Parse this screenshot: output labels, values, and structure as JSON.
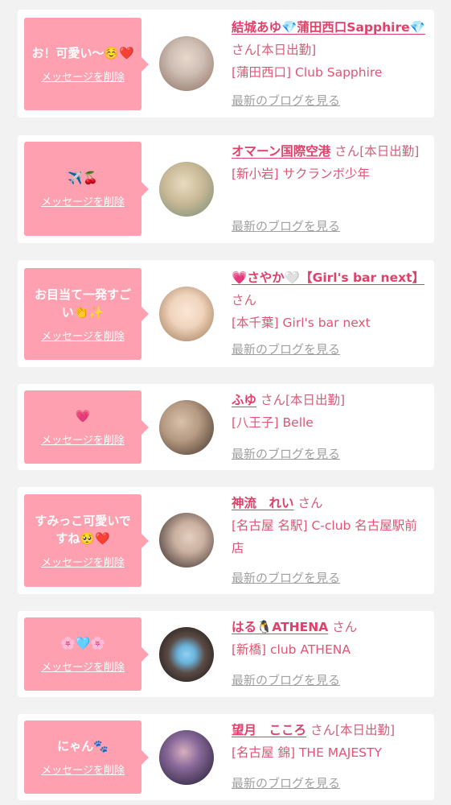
{
  "delete_label": "メッセージを削除",
  "blog_label": "最新のブログを見る",
  "san_label": "さん",
  "cards": [
    {
      "message": "お！可愛い〜☺️❤️",
      "name": "結城あゆ💎蒲田西口Sapphire💎",
      "status": "[本日出勤]",
      "shop": "[蒲田西口] Club Sapphire",
      "avatar_colors": [
        "#cdbdb3",
        "#8e6e60"
      ]
    },
    {
      "message": "✈️🍒",
      "name": "オマーン国際空港",
      "status": "[本日出勤]",
      "shop": "[新小岩] サクランボ少年",
      "avatar_colors": [
        "#c8b896",
        "#6f8a76"
      ]
    },
    {
      "message": "お目当て一発すごい👏✨",
      "name": "💗さやか🤍【Girl's bar next】",
      "status": "",
      "shop": "[本千葉] Girl's bar next",
      "avatar_colors": [
        "#f0d4bd",
        "#9a7450"
      ]
    },
    {
      "message": "💗",
      "name": "ふゆ",
      "status": "[本日出勤]",
      "shop": "[八王子] Belle",
      "avatar_colors": [
        "#b69a82",
        "#3e3028"
      ]
    },
    {
      "message": "すみっこ可愛いですね🥺❤️",
      "name": "神流　れい",
      "status": "",
      "shop": "[名古屋 名駅] C-club 名古屋駅前店",
      "avatar_colors": [
        "#cab0a0",
        "#2a2020"
      ]
    },
    {
      "message": "🌸🩵🌸",
      "name": "はる🐧ATHENA",
      "status": "",
      "shop": "[新橋] club ATHENA",
      "avatar_colors": [
        "#5a4a44",
        "#151212"
      ]
    },
    {
      "message": "にゃん🐾",
      "name": "望月　こころ",
      "status": "[本日出勤]",
      "shop": "[名古屋 錦] THE MAJESTY",
      "avatar_colors": [
        "#8a6a9a",
        "#1c1830"
      ]
    }
  ]
}
